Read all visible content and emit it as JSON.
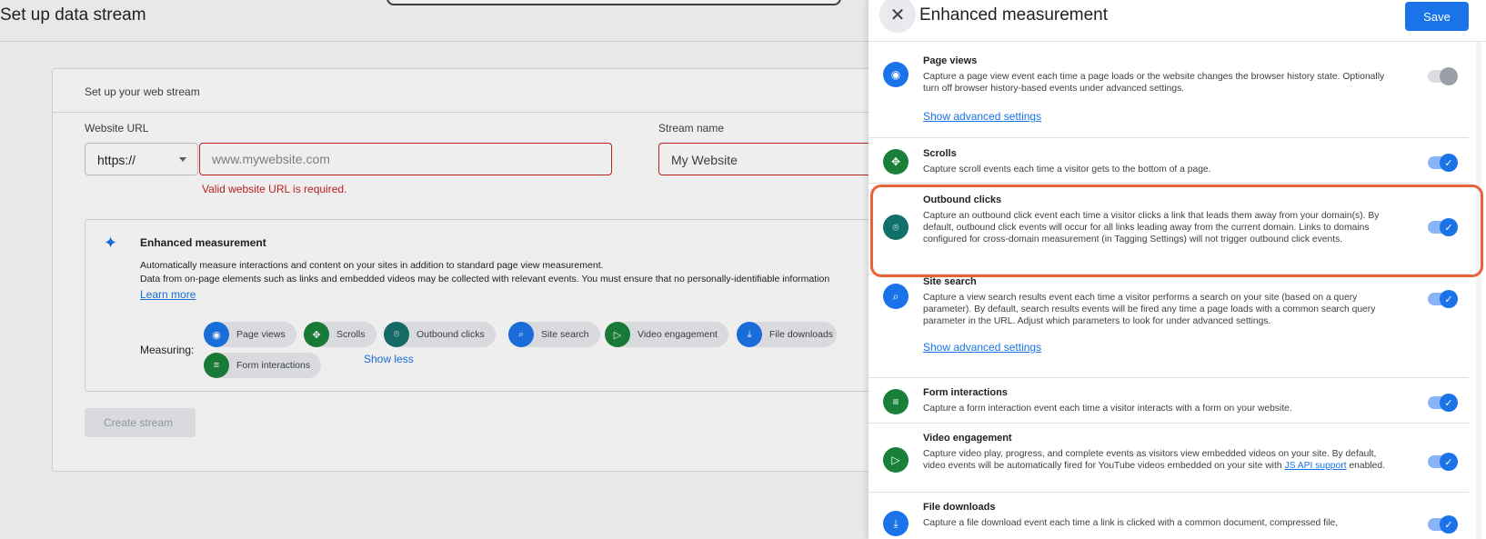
{
  "background": {
    "title": "Set up data stream",
    "card_header": "Set up your web stream",
    "website_url_label": "Website URL",
    "protocol_value": "https://",
    "url_placeholder": "www.mywebsite.com",
    "url_error": "Valid website URL is required.",
    "stream_name_label": "Stream name",
    "stream_name_value": "My Website",
    "enhanced": {
      "title": "Enhanced measurement",
      "desc1": "Automatically measure interactions and content on your sites in addition to standard page view measurement.",
      "desc2": "Data from on-page elements such as links and embedded videos may be collected with relevant events. You must ensure that no personally-identifiable information",
      "learn_more": "Learn more",
      "measuring_label": "Measuring:",
      "chips": [
        "Page views",
        "Scrolls",
        "Outbound clicks",
        "Site search",
        "Video engagement",
        "File downloads",
        "Form interactions"
      ],
      "show_less": "Show less"
    },
    "create_stream": "Create stream"
  },
  "panel": {
    "title": "Enhanced measurement",
    "save_label": "Save",
    "rows": [
      {
        "title": "Page views",
        "desc": "Capture a page view event each time a page loads or the website changes the browser history state. Optionally turn off browser history-based events under advanced settings.",
        "advanced": "Show advanced settings",
        "enabled": true
      },
      {
        "title": "Scrolls",
        "desc": "Capture scroll events each time a visitor gets to the bottom of a page.",
        "enabled": true
      },
      {
        "title": "Outbound clicks",
        "desc": "Capture an outbound click event each time a visitor clicks a link that leads them away from your domain(s). By default, outbound click events will occur for all links leading away from the current domain. Links to domains configured for cross-domain measurement (in Tagging Settings) will not trigger outbound click events.",
        "enabled": true
      },
      {
        "title": "Site search",
        "desc": "Capture a view search results event each time a visitor performs a search on your site (based on a query parameter). By default, search results events will be fired any time a page loads with a common search query parameter in the URL. Adjust which parameters to look for under advanced settings.",
        "advanced": "Show advanced settings",
        "enabled": true
      },
      {
        "title": "Form interactions",
        "desc": "Capture a form interaction event each time a visitor interacts with a form on your website.",
        "enabled": true
      },
      {
        "title": "Video engagement",
        "desc_pre": "Capture video play, progress, and complete events as visitors view embedded videos on your site. By default, video events will be automatically fired for YouTube videos embedded on your site with",
        "desc_link": "JS API support",
        "desc_post": "enabled.",
        "enabled": true
      },
      {
        "title": "File downloads",
        "desc": "Capture a file download event each time a link is clicked with a common document, compressed file,",
        "enabled": true
      }
    ]
  },
  "colors": {
    "primary": "#1a73e8",
    "error": "#c5221f",
    "highlight": "#e8623a",
    "icon_blue": "#1a73e8",
    "icon_green": "#188038",
    "icon_teal": "#12706b"
  }
}
